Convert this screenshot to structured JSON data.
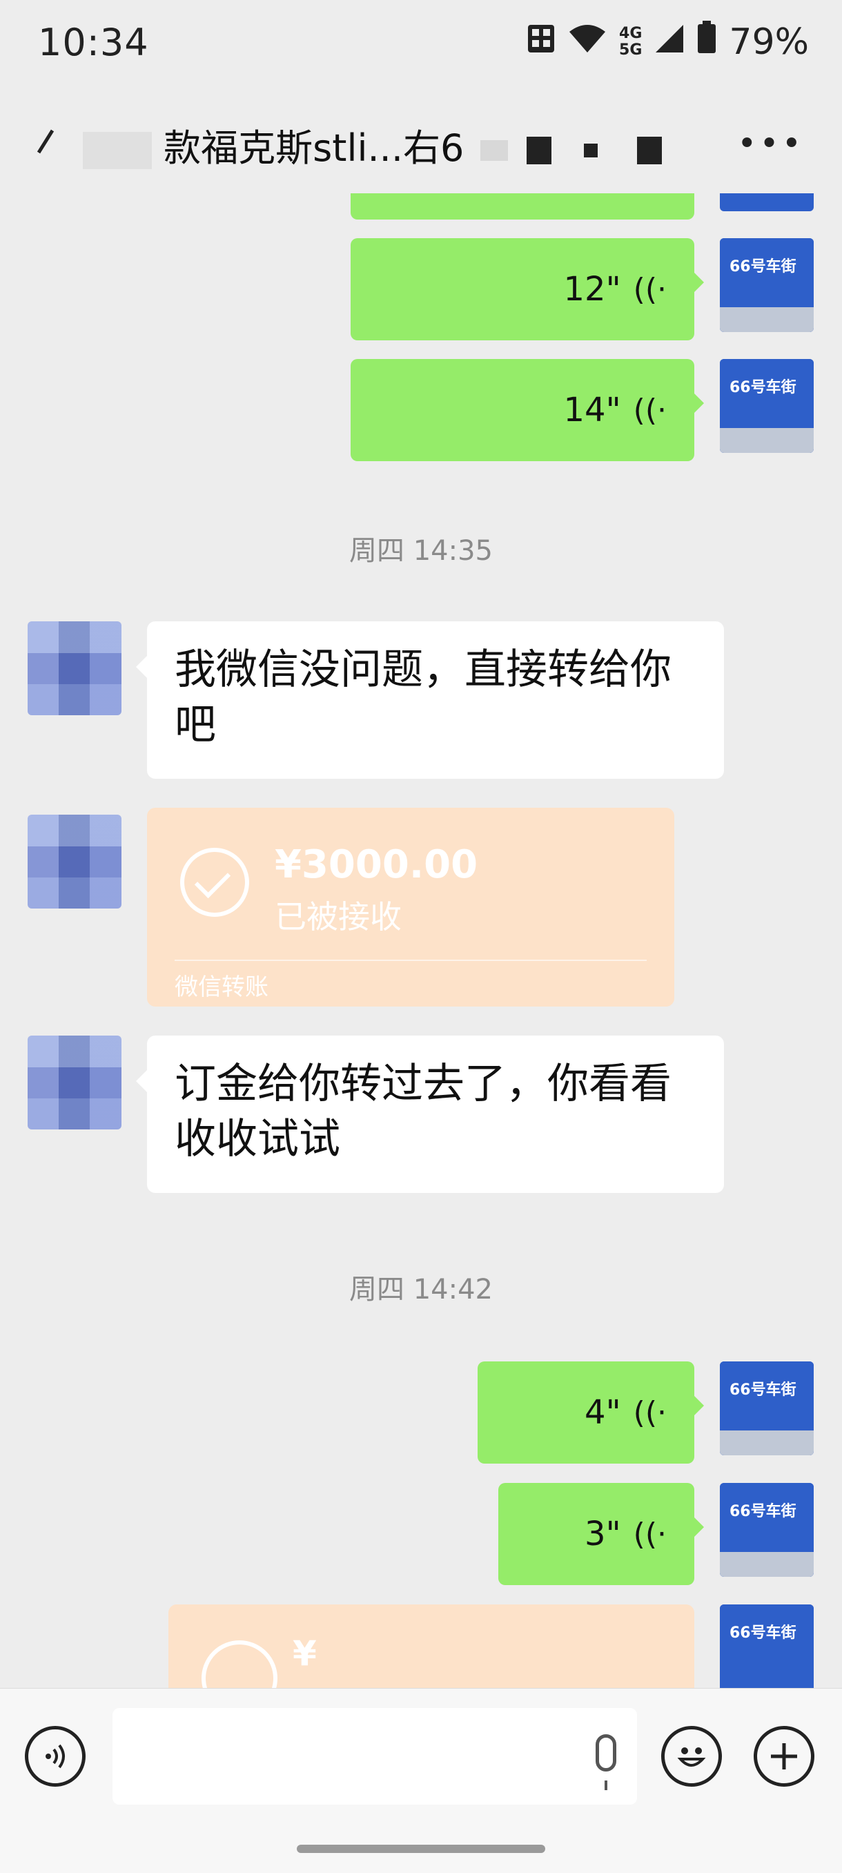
{
  "status_bar": {
    "time": "10:34",
    "network_top": "4G",
    "network_bottom": "5G",
    "battery": "79%"
  },
  "chat": {
    "title": "款福克斯stli...右6"
  },
  "messages": {
    "voice_1": "12\"",
    "voice_2": "14\"",
    "time_1": "周四 14:35",
    "text_1": "我微信没问题，直接转给你吧",
    "transfer_amount": "¥3000.00",
    "transfer_status": "已被接收",
    "transfer_footer": "微信转账",
    "text_2": "订金给你转过去了，你看看收收试试",
    "time_2": "周四 14:42",
    "voice_3": "4\"",
    "voice_4": "3\"",
    "partial_amount": "¥"
  },
  "avatar_text": "66号车街",
  "colors": {
    "sent_bubble": "#95ec69",
    "transfer_card": "#fde2c9",
    "background": "#ededed"
  }
}
